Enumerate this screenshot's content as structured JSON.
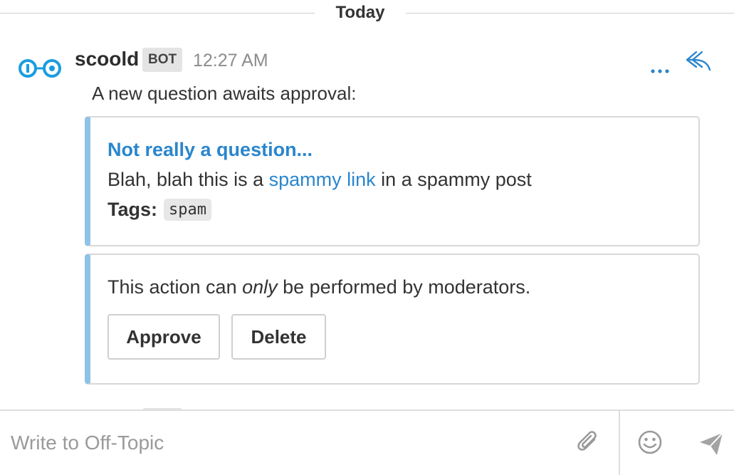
{
  "divider": {
    "label": "Today"
  },
  "message": {
    "sender": "scoold",
    "badge": "BOT",
    "time": "12:27 AM",
    "text": "A new question awaits approval:"
  },
  "attachment": {
    "title": "Not really a question...",
    "body_prefix": "Blah, blah this is a ",
    "body_link": "spammy link",
    "body_suffix": " in a spammy post",
    "tags_label": "Tags:",
    "tags": [
      "spam"
    ]
  },
  "actions": {
    "notice_prefix": "This action can ",
    "notice_emphasis": "only",
    "notice_suffix": " be performed by moderators.",
    "approve_label": "Approve",
    "delete_label": "Delete"
  },
  "composer": {
    "placeholder": "Write to Off-Topic"
  },
  "icons": {
    "avatar": "scoold-logo-icon",
    "more": "more-options-icon",
    "reply": "reply-icon",
    "attach": "paperclip-icon",
    "emoji": "emoji-icon",
    "send": "send-icon"
  },
  "colors": {
    "accent": "#2a86cd",
    "attachment_border": "#8ec3e6",
    "muted": "#8c8c8c",
    "badge_bg": "#e4e4e4"
  }
}
